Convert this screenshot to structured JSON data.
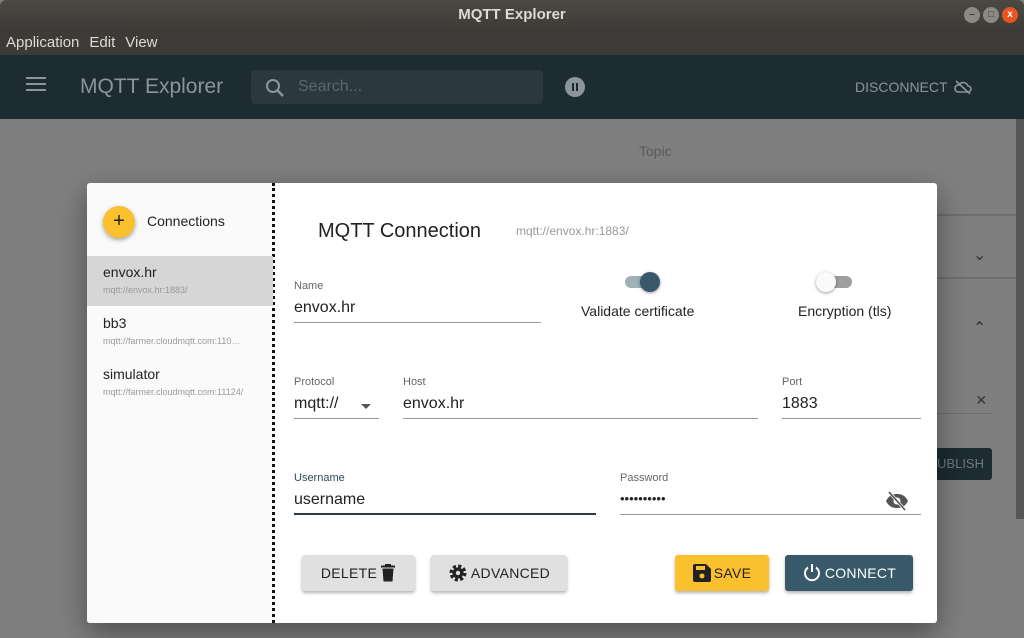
{
  "window": {
    "title": "MQTT Explorer",
    "controls": [
      "–",
      "□",
      "x"
    ]
  },
  "menu": [
    "Application",
    "Edit",
    "View"
  ],
  "appbar": {
    "title": "MQTT Explorer",
    "search_placeholder": "Search...",
    "disconnect": "DISCONNECT"
  },
  "background": {
    "topic": "Topic",
    "publish": "UBLISH",
    "clear": "×"
  },
  "sidebar": {
    "add": "+",
    "heading": "Connections",
    "items": [
      {
        "name": "envox.hr",
        "url": "mqtt://envox.hr:1883/",
        "selected": true
      },
      {
        "name": "bb3",
        "url": "mqtt://farmer.cloudmqtt.com:110…"
      },
      {
        "name": "simulator",
        "url": "mqtt://farmer.cloudmqtt.com:11124/"
      }
    ]
  },
  "form": {
    "title": "MQTT Connection",
    "url": "mqtt://envox.hr:1883/",
    "name_label": "Name",
    "name": "envox.hr",
    "validate_label": "Validate certificate",
    "validate_on": true,
    "tls_label": "Encryption (tls)",
    "tls_on": false,
    "protocol_label": "Protocol",
    "protocol": "mqtt://",
    "host_label": "Host",
    "host": "envox.hr",
    "port_label": "Port",
    "port": "1883",
    "username_label": "Username",
    "username": "username",
    "password_label": "Password",
    "password": "••••••••••",
    "delete": "DELETE",
    "advanced": "ADVANCED",
    "save": "SAVE",
    "connect": "CONNECT"
  },
  "colors": {
    "accent": "#fbc02d",
    "primary": "#37596a",
    "appbar": "#1d2b33"
  }
}
